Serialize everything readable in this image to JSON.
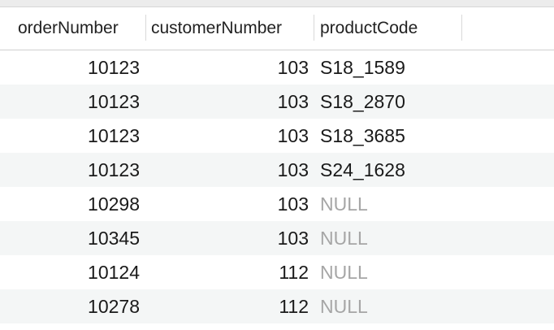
{
  "columns": {
    "order": "orderNumber",
    "customer": "customerNumber",
    "product": "productCode"
  },
  "rows": [
    {
      "orderNumber": "10123",
      "customerNumber": "103",
      "productCode": "S18_1589"
    },
    {
      "orderNumber": "10123",
      "customerNumber": "103",
      "productCode": "S18_2870"
    },
    {
      "orderNumber": "10123",
      "customerNumber": "103",
      "productCode": "S18_3685"
    },
    {
      "orderNumber": "10123",
      "customerNumber": "103",
      "productCode": "S24_1628"
    },
    {
      "orderNumber": "10298",
      "customerNumber": "103",
      "productCode": "NULL"
    },
    {
      "orderNumber": "10345",
      "customerNumber": "103",
      "productCode": "NULL"
    },
    {
      "orderNumber": "10124",
      "customerNumber": "112",
      "productCode": "NULL"
    },
    {
      "orderNumber": "10278",
      "customerNumber": "112",
      "productCode": "NULL"
    }
  ]
}
